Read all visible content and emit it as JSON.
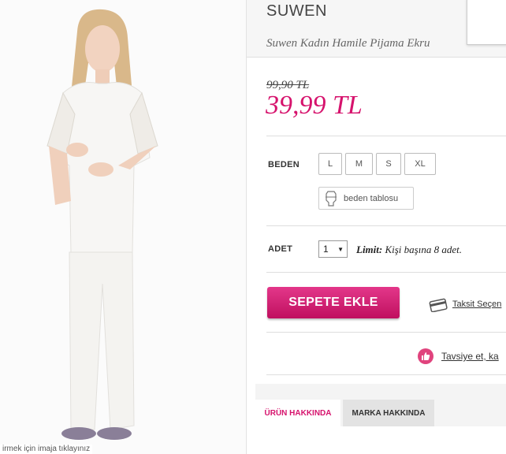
{
  "photo": {
    "caption": "irmek için imaja tıklayınız"
  },
  "product": {
    "brand": "SUWEN",
    "name": "Suwen Kadın Hamile Pijama Ekru",
    "old_price": "99,90 TL",
    "price": "39,99 TL"
  },
  "size": {
    "label": "BEDEN",
    "options": [
      "L",
      "M",
      "S",
      "XL"
    ],
    "chart_label": "beden tablosu"
  },
  "quantity": {
    "label": "ADET",
    "value": "1",
    "limit_label": "Limit:",
    "limit_text": " Kişi başına 8 adet."
  },
  "actions": {
    "add_to_cart": "SEPETE EKLE",
    "installment": "Taksit Seçen",
    "recommend": "Tavsiye et, ka"
  },
  "tabs": [
    {
      "label": "ÜRÜN HAKKINDA",
      "active": true
    },
    {
      "label": "MARKA HAKKINDA",
      "active": false
    }
  ],
  "colors": {
    "accent": "#d6136d"
  }
}
